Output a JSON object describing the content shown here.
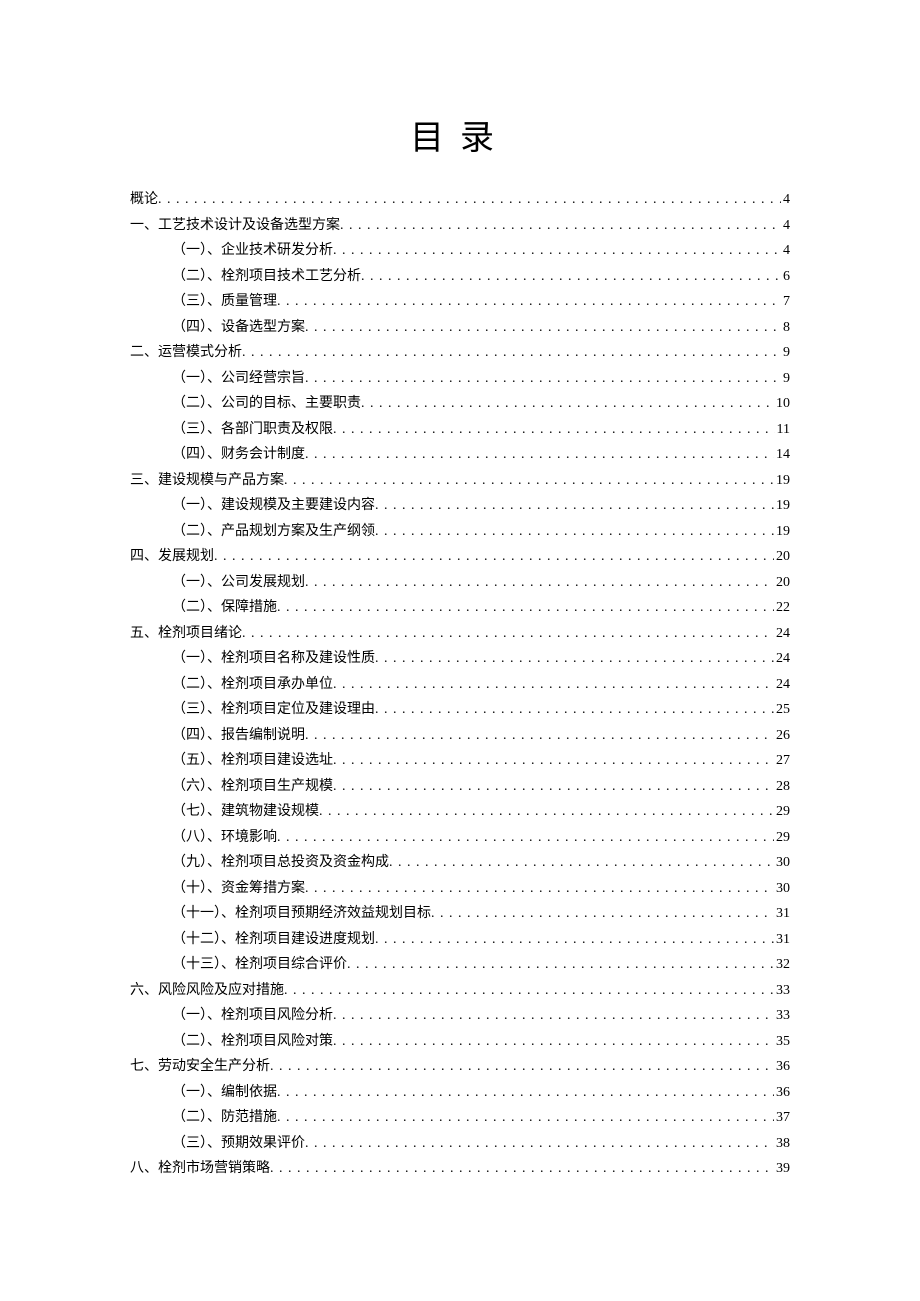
{
  "title": "目录",
  "toc": [
    {
      "level": 0,
      "label": "概论",
      "page": "4"
    },
    {
      "level": 0,
      "label": "一、工艺技术设计及设备选型方案",
      "page": "4"
    },
    {
      "level": 1,
      "label": "（一）、企业技术研发分析",
      "page": "4"
    },
    {
      "level": 1,
      "label": "（二）、栓剂项目技术工艺分析",
      "page": "6"
    },
    {
      "level": 1,
      "label": "（三）、质量管理",
      "page": "7"
    },
    {
      "level": 1,
      "label": "（四）、设备选型方案",
      "page": "8"
    },
    {
      "level": 0,
      "label": "二、运营模式分析",
      "page": "9"
    },
    {
      "level": 1,
      "label": "（一）、公司经营宗旨",
      "page": "9"
    },
    {
      "level": 1,
      "label": "（二）、公司的目标、主要职责",
      "page": "10"
    },
    {
      "level": 1,
      "label": "（三）、各部门职责及权限",
      "page": "11"
    },
    {
      "level": 1,
      "label": "（四）、财务会计制度",
      "page": "14"
    },
    {
      "level": 0,
      "label": "三、建设规模与产品方案",
      "page": "19"
    },
    {
      "level": 1,
      "label": "（一）、建设规模及主要建设内容",
      "page": "19"
    },
    {
      "level": 1,
      "label": "（二）、产品规划方案及生产纲领",
      "page": "19"
    },
    {
      "level": 0,
      "label": "四、发展规划",
      "page": "20"
    },
    {
      "level": 1,
      "label": "（一）、公司发展规划",
      "page": "20"
    },
    {
      "level": 1,
      "label": "（二）、保障措施",
      "page": "22"
    },
    {
      "level": 0,
      "label": "五、栓剂项目绪论",
      "page": "24"
    },
    {
      "level": 1,
      "label": "（一）、栓剂项目名称及建设性质",
      "page": "24"
    },
    {
      "level": 1,
      "label": "（二）、栓剂项目承办单位",
      "page": "24"
    },
    {
      "level": 1,
      "label": "（三）、栓剂项目定位及建设理由",
      "page": "25"
    },
    {
      "level": 1,
      "label": "（四）、报告编制说明",
      "page": "26"
    },
    {
      "level": 1,
      "label": "（五）、栓剂项目建设选址",
      "page": "27"
    },
    {
      "level": 1,
      "label": "（六）、栓剂项目生产规模",
      "page": "28"
    },
    {
      "level": 1,
      "label": "（七）、建筑物建设规模",
      "page": "29"
    },
    {
      "level": 1,
      "label": "（八）、环境影响",
      "page": "29"
    },
    {
      "level": 1,
      "label": "（九）、栓剂项目总投资及资金构成",
      "page": "30"
    },
    {
      "level": 1,
      "label": "（十）、资金筹措方案",
      "page": "30"
    },
    {
      "level": 1,
      "label": "（十一）、栓剂项目预期经济效益规划目标",
      "page": "31"
    },
    {
      "level": 1,
      "label": "（十二）、栓剂项目建设进度规划",
      "page": "31"
    },
    {
      "level": 1,
      "label": "（十三）、栓剂项目综合评价",
      "page": "32"
    },
    {
      "level": 0,
      "label": "六、风险风险及应对措施",
      "page": "33"
    },
    {
      "level": 1,
      "label": "（一）、栓剂项目风险分析",
      "page": "33"
    },
    {
      "level": 1,
      "label": "（二）、栓剂项目风险对策",
      "page": "35"
    },
    {
      "level": 0,
      "label": "七、劳动安全生产分析",
      "page": "36"
    },
    {
      "level": 1,
      "label": "（一）、编制依据",
      "page": "36"
    },
    {
      "level": 1,
      "label": "（二）、防范措施",
      "page": "37"
    },
    {
      "level": 1,
      "label": "（三）、预期效果评价",
      "page": "38"
    },
    {
      "level": 0,
      "label": "八、栓剂市场营销策略",
      "page": "39"
    }
  ]
}
